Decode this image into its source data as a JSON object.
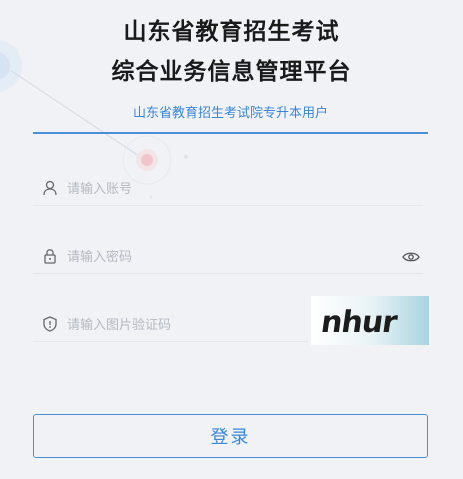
{
  "header": {
    "title_line1": "山东省教育招生考试",
    "title_line2": "综合业务信息管理平台"
  },
  "tab": {
    "label": "山东省教育招生考试院专升本用户"
  },
  "form": {
    "account": {
      "placeholder": "请输入账号",
      "icon": "user-icon"
    },
    "password": {
      "placeholder": "请输入密码",
      "icon": "lock-icon",
      "toggle_icon": "eye-icon"
    },
    "captcha": {
      "placeholder": "请输入图片验证码",
      "icon": "shield-icon",
      "image_text": "nhur"
    }
  },
  "actions": {
    "login_label": "登录"
  },
  "colors": {
    "accent": "#3b86d6",
    "background": "#f0f2f6"
  }
}
